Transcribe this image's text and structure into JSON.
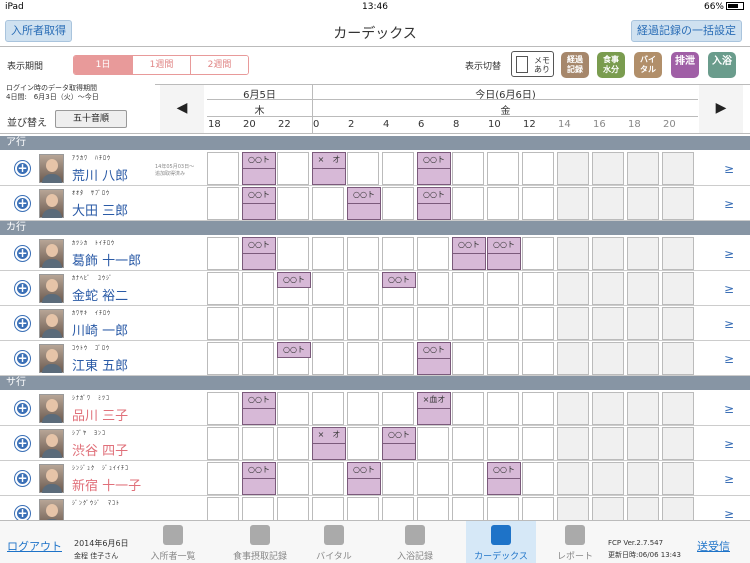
{
  "status": {
    "carrier": "iPad",
    "time": "13:46",
    "battery": "66%"
  },
  "nav": {
    "left_button": "入所者取得",
    "title": "カーデックス",
    "right_button": "経過記録の一括設定"
  },
  "period": {
    "label": "表示期間",
    "options": [
      "1日",
      "1週間",
      "2週間"
    ],
    "selected": "1日"
  },
  "toggle": {
    "label": "表示切替",
    "memo": "メモ\nあり",
    "buttons": [
      {
        "label": "経過\n記録",
        "color": "#a6876b"
      },
      {
        "label": "食事\n水分",
        "color": "#7a9c4f"
      },
      {
        "label": "バイ\nタル",
        "color": "#b18f6a"
      },
      {
        "label": "排泄",
        "color": "#a05fa6"
      },
      {
        "label": "入浴",
        "color": "#6a9c8c"
      }
    ]
  },
  "info": {
    "line1": "ログイン時のデータ取得期間",
    "line2": "4日間:　6月3日（火）〜今日"
  },
  "sort": {
    "label": "並び替え",
    "button": "五十音順"
  },
  "days": {
    "prev": "6月5日",
    "prev_dow": "木",
    "today": "今日(6月6日)",
    "today_dow": "金"
  },
  "hours": [
    "18",
    "20",
    "22",
    "0",
    "2",
    "4",
    "6",
    "8",
    "10",
    "12",
    "14",
    "16",
    "18",
    "20"
  ],
  "sections": [
    {
      "label": "ア行",
      "rows": [
        {
          "kana": "ｱﾗｶﾜ　ﾊﾁﾛｳ",
          "name": "荒川 八郎",
          "color": "blue",
          "note": "14年05月03日〜\n追加取得済み",
          "entries": [
            {
              "c": 1,
              "t": "○○ト",
              "full": true
            },
            {
              "c": 3,
              "t": "×　オ",
              "full": true
            },
            {
              "c": 6,
              "t": "○○ト",
              "full": true
            }
          ]
        },
        {
          "kana": "ｵｵﾀ　ｻﾌﾞﾛｳ",
          "name": "大田 三郎",
          "color": "blue",
          "entries": [
            {
              "c": 1,
              "t": "○○ト",
              "full": true
            },
            {
              "c": 4,
              "t": "○○ト",
              "full": true
            },
            {
              "c": 6,
              "t": "○○ト",
              "full": true
            }
          ]
        }
      ]
    },
    {
      "label": "カ行",
      "rows": [
        {
          "kana": "ｶﾂｼｶ　ﾄｲﾁﾛｳ",
          "name": "葛飾 十一郎",
          "color": "blue",
          "entries": [
            {
              "c": 1,
              "t": "○○ト",
              "full": true
            },
            {
              "c": 7,
              "t": "○○ト",
              "full": true
            },
            {
              "c": 8,
              "t": "○○ト",
              "full": true
            }
          ]
        },
        {
          "kana": "ｶﾅﾍﾋﾞ　ﾕｳｼﾞ",
          "name": "金蛇 裕二",
          "color": "blue",
          "entries": [
            {
              "c": 2,
              "t": "○○ト",
              "full": false
            },
            {
              "c": 5,
              "t": "○○ト",
              "full": false
            }
          ]
        },
        {
          "kana": "ｶﾜｻｷ　ｲﾁﾛｳ",
          "name": "川崎 一郎",
          "color": "blue",
          "entries": []
        },
        {
          "kana": "ｺｳﾄｳ　ｺﾞﾛｳ",
          "name": "江東 五郎",
          "color": "blue",
          "entries": [
            {
              "c": 2,
              "t": "○○ト",
              "full": false
            },
            {
              "c": 6,
              "t": "○○ト",
              "full": true
            }
          ]
        }
      ]
    },
    {
      "label": "サ行",
      "rows": [
        {
          "kana": "ｼﾅｶﾞﾜ　ﾐﾂｺ",
          "name": "品川 三子",
          "color": "pink",
          "entries": [
            {
              "c": 1,
              "t": "○○ト",
              "full": true
            },
            {
              "c": 6,
              "t": "×血オ",
              "full": true
            }
          ]
        },
        {
          "kana": "ｼﾌﾞﾔ　ﾖﾝｺ",
          "name": "渋谷 四子",
          "color": "pink",
          "entries": [
            {
              "c": 3,
              "t": "×　オ",
              "full": true
            },
            {
              "c": 5,
              "t": "○○ト",
              "full": true
            }
          ]
        },
        {
          "kana": "ｼﾝｼﾞｭｸ　ｼﾞｭｲｲﾁｺ",
          "name": "新宿 十一子",
          "color": "pink",
          "entries": [
            {
              "c": 1,
              "t": "○○ト",
              "full": true
            },
            {
              "c": 4,
              "t": "○○ト",
              "full": true
            },
            {
              "c": 8,
              "t": "○○ト",
              "full": true
            }
          ]
        },
        {
          "kana": "ｼﾞﾝｸﾞｳｼﾞ　ﾏｺﾄ",
          "name": "",
          "color": "blue",
          "entries": []
        }
      ]
    }
  ],
  "footer": {
    "logout": "ログアウト",
    "date": "2014年6月6日",
    "user": "金程 佳子さん",
    "tabs": [
      "入所者一覧",
      "食事摂取記録",
      "バイタル",
      "入浴記録",
      "カーデックス",
      "レポート"
    ],
    "active_tab": "カーデックス",
    "version": "FCP Ver.2.7.547",
    "updated": "更新日時:06/06 13:43",
    "send": "送受信"
  }
}
